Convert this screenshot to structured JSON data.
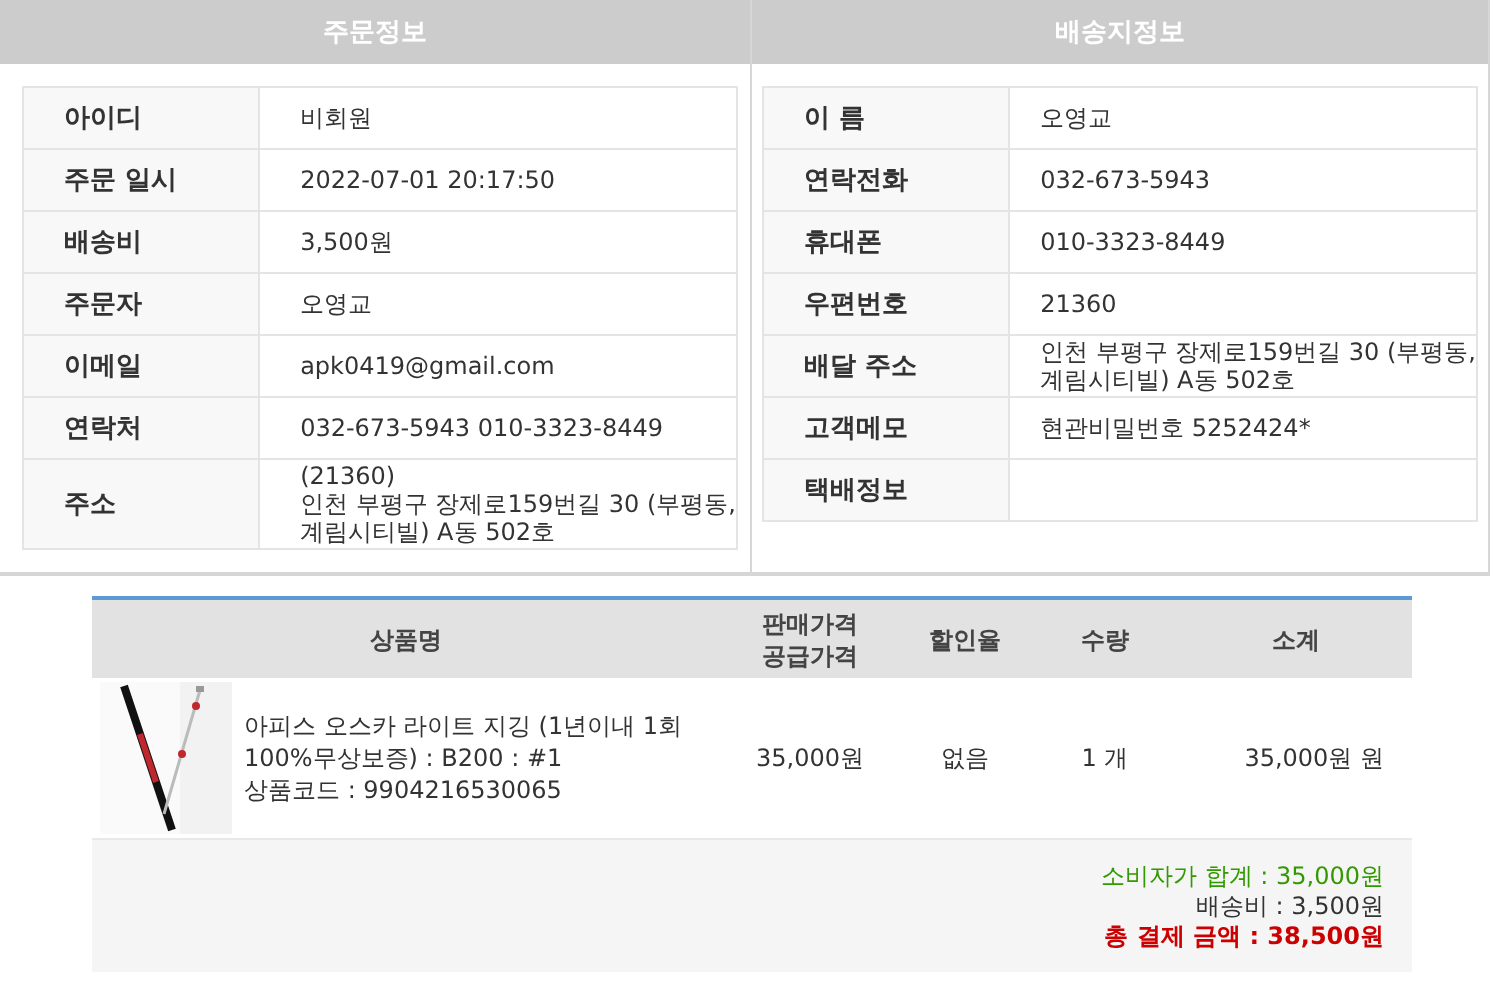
{
  "order_info": {
    "title": "주문정보",
    "rows": [
      {
        "label": "아이디",
        "lines": [
          "비회원"
        ]
      },
      {
        "label": "주문 일시",
        "lines": [
          "2022-07-01 20:17:50"
        ]
      },
      {
        "label": "배송비",
        "lines": [
          "3,500원"
        ]
      },
      {
        "label": "주문자",
        "lines": [
          "오영교"
        ]
      },
      {
        "label": "이메일",
        "lines": [
          "apk0419@gmail.com"
        ]
      },
      {
        "label": "연락처",
        "lines": [
          "032-673-5943 010-3323-8449"
        ]
      },
      {
        "label": "주소",
        "lines": [
          "(21360)",
          "인천 부평구 장제로159번길 30 (부평동,",
          "계림시티빌) A동 502호"
        ]
      }
    ]
  },
  "delivery_info": {
    "title": "배송지정보",
    "rows": [
      {
        "label": "이 름",
        "lines": [
          "오영교"
        ]
      },
      {
        "label": "연락전화",
        "lines": [
          "032-673-5943"
        ]
      },
      {
        "label": "휴대폰",
        "lines": [
          "010-3323-8449"
        ]
      },
      {
        "label": "우편번호",
        "lines": [
          "21360"
        ]
      },
      {
        "label": "배달 주소",
        "lines": [
          "인천 부평구 장제로159번길 30 (부평동,",
          "계림시티빌) A동 502호"
        ]
      },
      {
        "label": "고객메모",
        "lines": [
          "현관비밀번호 5252424*"
        ]
      },
      {
        "label": "택배정보",
        "lines": []
      }
    ]
  },
  "products": {
    "columns": [
      {
        "label": "상품명"
      },
      {
        "label": "판매가격",
        "sublabel": "공급가격"
      },
      {
        "label": "할인율"
      },
      {
        "label": "수량"
      },
      {
        "label": "소계"
      }
    ],
    "rows": [
      {
        "image": {
          "kind": "picture"
        },
        "name_lines": [
          "아피스 오스카 라이트 지깅 (1년이내 1회",
          "100%무상보증) : B200 : #1"
        ],
        "code": "상품코드 : 9904216530065",
        "price": "35,000원",
        "discount": "없음",
        "quantity": "1 개",
        "subtotal": "35,000원 원"
      }
    ],
    "totals": [
      {
        "kind": "consumer",
        "text": "소비자가 합계 : 35,000원"
      },
      {
        "kind": "shipping",
        "text": "배송비 : 3,500원"
      },
      {
        "kind": "grand",
        "text": "총 결제 금액 : 38,500원"
      }
    ]
  }
}
